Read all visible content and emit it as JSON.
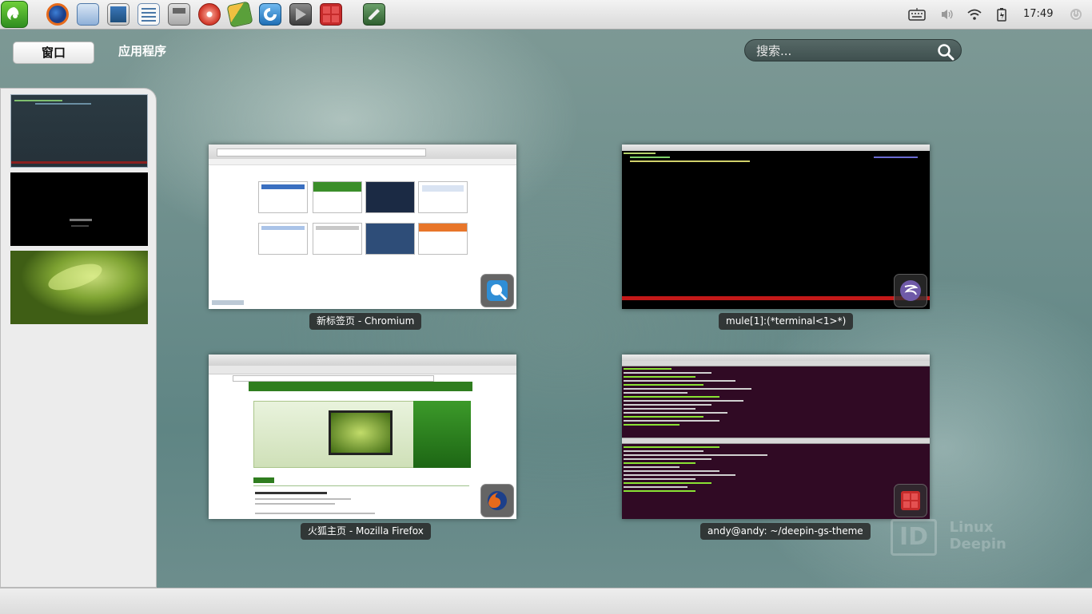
{
  "top_panel": {
    "apps": [
      {
        "name": "deepin-menu-icon",
        "color": "#3a9a2a"
      },
      {
        "name": "firefox-icon",
        "color": "#e66a1c"
      },
      {
        "name": "mail-icon",
        "color": "#2c6fb5"
      },
      {
        "name": "image-viewer-icon",
        "color": "#3b77b9"
      },
      {
        "name": "document-viewer-icon",
        "color": "#4a78a8"
      },
      {
        "name": "file-manager-icon",
        "color": "#8a8a8a"
      },
      {
        "name": "disc-burner-icon",
        "color": "#d23a2c"
      },
      {
        "name": "software-center-icon",
        "color": "#5aa03a"
      },
      {
        "name": "chromium-icon",
        "color": "#2f8ed6"
      },
      {
        "name": "media-player-icon",
        "color": "#555555"
      },
      {
        "name": "terminal-icon",
        "color": "#c62b2b"
      },
      {
        "name": "text-editor-icon",
        "color": "#3e7a3e"
      }
    ],
    "clock": "17:49"
  },
  "mode_tabs": {
    "windows": "窗口",
    "applications": "应用程序"
  },
  "search": {
    "placeholder": "搜索..."
  },
  "windows": [
    {
      "title": "新标签页 - Chromium"
    },
    {
      "title": "mule[1]:(*terminal<1>*)"
    },
    {
      "title": "火狐主页 - Mozilla Firefox"
    },
    {
      "title": "andy@andy: ~/deepin-gs-theme"
    }
  ],
  "watermark": {
    "brand": "ID",
    "line1": "Linux",
    "line2": "Deepin"
  },
  "colors": {
    "accent": "#5f8584",
    "terminal_bg": "#000000",
    "ubuntu_term_bg": "#300a24",
    "firefox_green": "#2f7d1f"
  }
}
